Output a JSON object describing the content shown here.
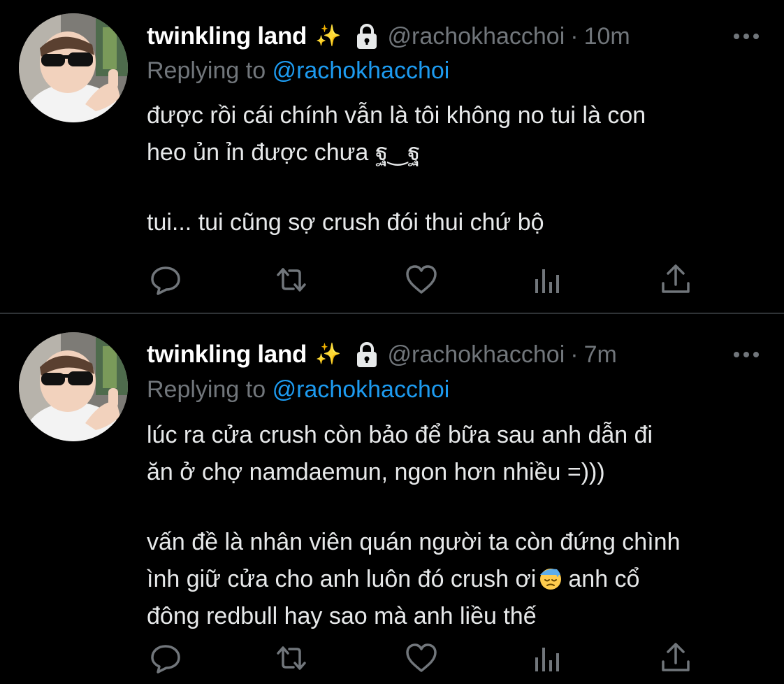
{
  "tweets": [
    {
      "display_name": "twinkling land",
      "sparkle": "✨",
      "handle": "@rachokhacchoi",
      "separator": "·",
      "time": "10m",
      "replying_prefix": "Replying to",
      "replying_to": "@rachokhacchoi",
      "paragraphs": [
        "được rồi cái chính vẫn là tôi không no tui là con\nheo ủn ỉn được chưa ฐ‿ฐ",
        "tui... tui cũng sợ crush đói thui chứ bộ"
      ]
    },
    {
      "display_name": "twinkling land",
      "sparkle": "✨",
      "handle": "@rachokhacchoi",
      "separator": "·",
      "time": "7m",
      "replying_prefix": "Replying to",
      "replying_to": "@rachokhacchoi",
      "paragraphs": [
        "lúc ra cửa crush còn bảo để bữa sau anh dẫn đi\năn ở chợ namdaemun, ngon hơn nhiều =)))",
        "vấn đề là nhân viên quán người ta còn đứng chình\nình giữ cửa cho anh luôn đó crush ơi"
      ],
      "after_emoji": "anh cổ\nđông redbull hay sao mà anh liều thế"
    }
  ],
  "icons": {
    "reply": "reply-icon",
    "retweet": "retweet-icon",
    "like": "heart-icon",
    "views": "views-icon",
    "share": "share-icon",
    "more": "more-icon",
    "lock": "lock-icon",
    "emoji": "downcast-face-with-sweat-emoji"
  },
  "colors": {
    "background": "#000000",
    "text": "#e7e9ea",
    "secondary": "#71767b",
    "link": "#1d9bf0",
    "divider": "#2f3336"
  }
}
